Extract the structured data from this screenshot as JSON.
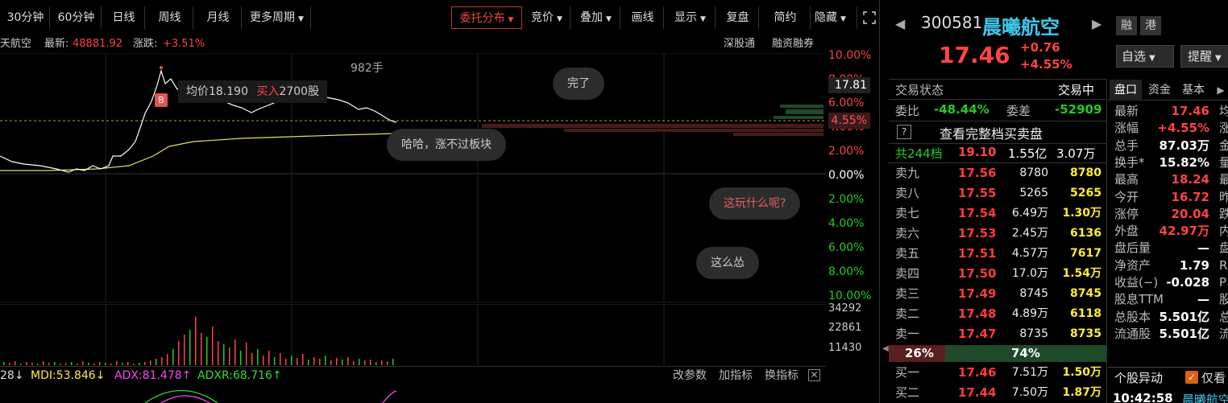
{
  "toolbar": {
    "min30": "30分钟",
    "min60": "60分钟",
    "daily": "日线",
    "weekly": "周线",
    "monthly": "月线",
    "more_periods": "更多周期",
    "order_dist": "委托分布",
    "auction": "竞价",
    "overlay": "叠加",
    "draw_line": "画线",
    "display": "显示",
    "replay": "复盘",
    "simple": "简约",
    "hide": "隐藏"
  },
  "info": {
    "stock_name": "天航空",
    "latest_label": "最新:",
    "latest_value": "48881.92",
    "change_label": "涨跌:",
    "change_value": "+3.51%",
    "link1": "深股通",
    "link2": "融资融券"
  },
  "chart": {
    "volume_annotation": "982手",
    "tooltip_avg": "均价18.190",
    "tooltip_buy": "买入",
    "tooltip_qty": "2700股",
    "marker_b": "B",
    "current_price_tag": "17.81",
    "current_pct_tag": "4.55%",
    "right_axis": [
      "10.00%",
      "8.00%",
      "6.00%",
      "4.00%",
      "2.00%",
      "0.00%",
      "2.00%",
      "4.00%",
      "6.00%",
      "8.00%",
      "10.00%"
    ],
    "volume_axis": [
      "34292",
      "22861",
      "11430"
    ],
    "comments": [
      "完了",
      "哈哈，涨不过板块",
      "这玩什么呢?",
      "这么怂"
    ],
    "line_color": "#ffffff",
    "avg_color": "#e8e05a"
  },
  "indicator": {
    "v1": "28↓",
    "mdi": "MDI:53.846↓",
    "adx": "ADX:81.478↑",
    "adxr": "ADXR:68.716↑",
    "btn_params": "改参数",
    "btn_add": "加指标",
    "btn_switch": "换指标"
  },
  "quote": {
    "code": "300581",
    "name": "晨曦航空",
    "tag1": "融",
    "tag2": "港",
    "price": "17.46",
    "change": "+0.76",
    "change_pct": "+4.55%",
    "btn_watch": "自选",
    "btn_remind": "提醒",
    "status_label": "交易状态",
    "status_value": "交易中",
    "ratio_label": "委比",
    "ratio_value": "-48.44%",
    "diff_label": "委差",
    "diff_value": "-52909",
    "question": "?",
    "full_book": "查看完整档买卖盘",
    "levels_label": "共244档",
    "levels_price": "19.10",
    "levels_amount": "1.55亿",
    "levels_vol": "3.07万",
    "sell": [
      {
        "label": "卖九",
        "price": "17.56",
        "vol": "8780",
        "cnt": "8780"
      },
      {
        "label": "卖八",
        "price": "17.55",
        "vol": "5265",
        "cnt": "5265"
      },
      {
        "label": "卖七",
        "price": "17.54",
        "vol": "6.49万",
        "cnt": "1.30万"
      },
      {
        "label": "卖六",
        "price": "17.53",
        "vol": "2.45万",
        "cnt": "6136"
      },
      {
        "label": "卖五",
        "price": "17.51",
        "vol": "4.57万",
        "cnt": "7617"
      },
      {
        "label": "卖四",
        "price": "17.50",
        "vol": "17.0万",
        "cnt": "1.54万"
      },
      {
        "label": "卖三",
        "price": "17.49",
        "vol": "8745",
        "cnt": "8745"
      },
      {
        "label": "卖二",
        "price": "17.48",
        "vol": "4.89万",
        "cnt": "6118"
      },
      {
        "label": "卖一",
        "price": "17.47",
        "vol": "8735",
        "cnt": "8735"
      }
    ],
    "bar_left": "26%",
    "bar_right": "74%",
    "buy": [
      {
        "label": "买一",
        "price": "17.46",
        "vol": "7.51万",
        "cnt": "1.50万"
      },
      {
        "label": "买二",
        "price": "17.44",
        "vol": "7.50万",
        "cnt": "1.87万"
      }
    ]
  },
  "tabs": {
    "book": "盘口",
    "capital": "资金",
    "basic": "基本"
  },
  "stats": [
    {
      "label": "最新",
      "value": "17.46",
      "color": "#ff4444",
      "tail": "均"
    },
    {
      "label": "涨幅",
      "value": "+4.55%",
      "color": "#ff4444",
      "tail": "涨"
    },
    {
      "label": "总手",
      "value": "87.03万",
      "color": "#ffffff",
      "tail": "金"
    },
    {
      "label": "换手*",
      "value": "15.82%",
      "color": "#ffffff",
      "tail": "量"
    },
    {
      "label": "最高",
      "value": "18.24",
      "color": "#ff4444",
      "tail": "最"
    },
    {
      "label": "今开",
      "value": "16.72",
      "color": "#ff4444",
      "tail": "昨"
    },
    {
      "label": "涨停",
      "value": "20.04",
      "color": "#ff4444",
      "tail": "跌"
    },
    {
      "label": "外盘",
      "value": "42.97万",
      "color": "#ff4444",
      "tail": "内"
    },
    {
      "label": "盘后量",
      "value": "—",
      "color": "#ffffff",
      "tail": "盘"
    },
    {
      "label": "净资产",
      "value": "1.79",
      "color": "#ffffff",
      "tail": "R"
    },
    {
      "label": "收益(−)",
      "value": "-0.028",
      "color": "#ffffff",
      "tail": "P"
    },
    {
      "label": "股息TTM",
      "value": "—",
      "color": "#ffffff",
      "tail": "股"
    },
    {
      "label": "总股本",
      "value": "5.501亿",
      "color": "#ffffff",
      "tail": "总"
    },
    {
      "label": "流通股",
      "value": "5.501亿",
      "color": "#ffffff",
      "tail": "流"
    }
  ],
  "alert": {
    "title": "个股异动",
    "checkbox_label": "仅看",
    "time": "10:42:58",
    "stock": "晨曦航空"
  },
  "colors": {
    "up": "#ff4444",
    "down": "#22cc22",
    "accent": "#c0392b",
    "sell_bar": "#5a1f1f",
    "buy_bar": "#1f4a2a"
  }
}
